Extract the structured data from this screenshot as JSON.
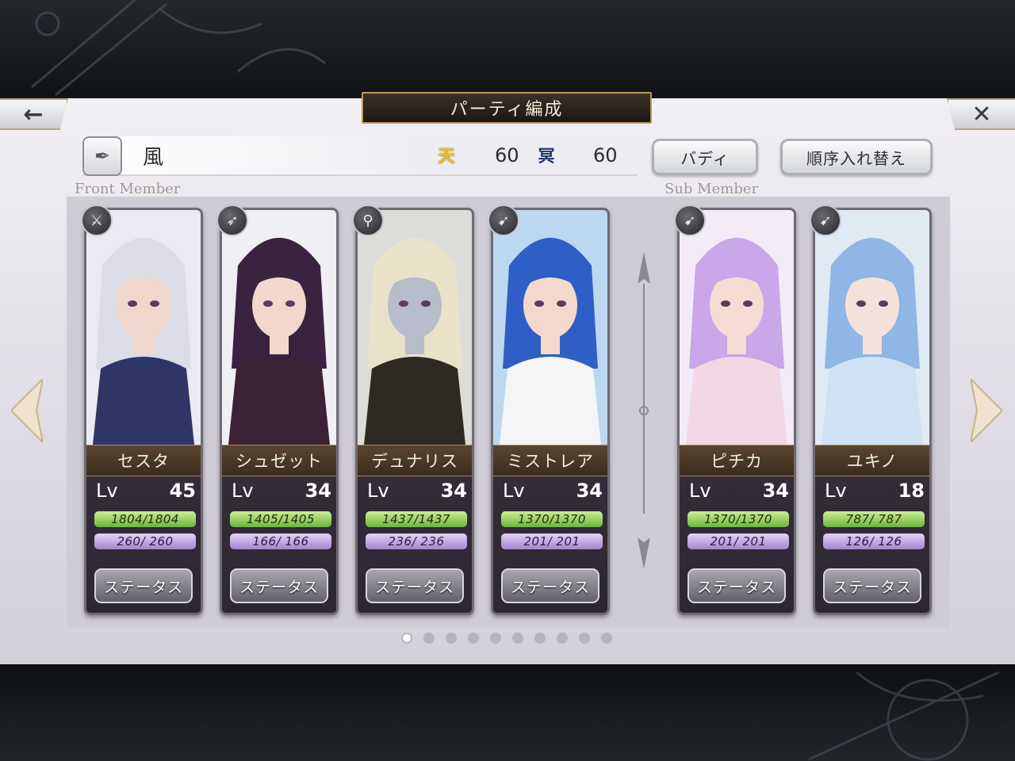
{
  "header": {
    "title": "パーティ編成",
    "back_icon": "←",
    "close_icon": "✕"
  },
  "element_bar": {
    "icon": "✒",
    "element": "風",
    "stat1_icon": "天",
    "stat1_value": "60",
    "stat2_icon": "冥",
    "stat2_value": "60"
  },
  "buttons": {
    "buddy": "バディ",
    "reorder": "順序入れ替え"
  },
  "sections": {
    "front": "Front Member",
    "sub": "Sub Member"
  },
  "cards": [
    {
      "name": "セスタ",
      "lv_label": "Lv",
      "lv": "45",
      "hp": "1804/1804",
      "sp": "260/ 260",
      "status": "ステータス",
      "weapon_icon": "sword-icon"
    },
    {
      "name": "シュゼット",
      "lv_label": "Lv",
      "lv": "34",
      "hp": "1405/1405",
      "sp": "166/ 166",
      "status": "ステータス",
      "weapon_icon": "spear-icon"
    },
    {
      "name": "デュナリス",
      "lv_label": "Lv",
      "lv": "34",
      "hp": "1437/1437",
      "sp": "236/ 236",
      "status": "ステータス",
      "weapon_icon": "staff-icon"
    },
    {
      "name": "ミストレア",
      "lv_label": "Lv",
      "lv": "34",
      "hp": "1370/1370",
      "sp": "201/ 201",
      "status": "ステータス",
      "weapon_icon": "bow-icon"
    },
    {
      "name": "ピチカ",
      "lv_label": "Lv",
      "lv": "34",
      "hp": "1370/1370",
      "sp": "201/ 201",
      "status": "ステータス",
      "weapon_icon": "bow-icon"
    },
    {
      "name": "ユキノ",
      "lv_label": "Lv",
      "lv": "18",
      "hp": "787/ 787",
      "sp": "126/ 126",
      "status": "ステータス",
      "weapon_icon": "bow-icon"
    }
  ],
  "pagination": {
    "total": 10,
    "active": 0
  },
  "colors": {
    "accent_gold": "#b89a5a",
    "hp_green": "#8fd054",
    "sp_purple": "#b79ce0",
    "stat1_yellow": "#e8c21a",
    "stat2_blue": "#23356f"
  }
}
